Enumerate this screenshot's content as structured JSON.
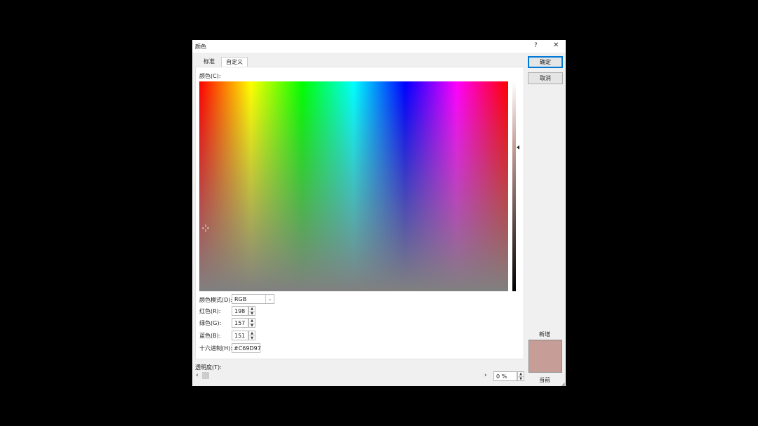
{
  "window": {
    "title": "颜色",
    "help": "?",
    "close": "✕"
  },
  "tabs": [
    {
      "label": "标准"
    },
    {
      "label": "自定义"
    }
  ],
  "colors_label": "颜色(C):",
  "mode": {
    "label": "颜色模式(D):",
    "value": "RGB"
  },
  "red": {
    "label": "红色(R):",
    "value": "198"
  },
  "green": {
    "label": "绿色(G):",
    "value": "157"
  },
  "blue": {
    "label": "蓝色(B):",
    "value": "151"
  },
  "hex": {
    "label": "十六进制(H):",
    "value": "#C69D97"
  },
  "transparency": {
    "label": "透明度(T):",
    "value": "0 %",
    "fraction": 0
  },
  "buttons": {
    "ok": "确定",
    "cancel": "取消"
  },
  "preview": {
    "new_label": "新增",
    "current_label": "当前",
    "color": "#C69D97"
  }
}
